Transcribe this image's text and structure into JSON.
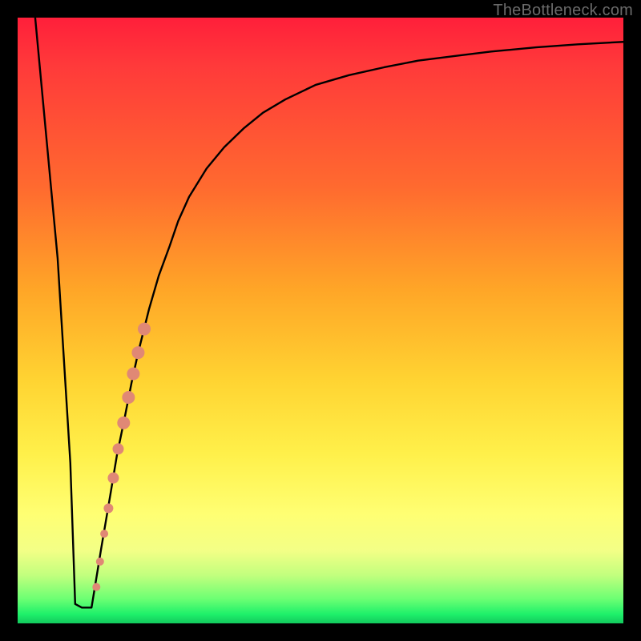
{
  "watermark": "TheBottleneck.com",
  "colors": {
    "background": "#000000",
    "curve": "#000000",
    "dot_fill": "#e08875",
    "gradient_top": "#ff1f3a",
    "gradient_bottom": "#13c95d"
  },
  "chart_data": {
    "type": "line",
    "title": "",
    "xlabel": "",
    "ylabel": "",
    "xlim": [
      0,
      100
    ],
    "ylim": [
      0,
      100
    ],
    "grid": false,
    "legend": false,
    "series": [
      {
        "name": "bottleneck-curve",
        "x": [
          2.9,
          6.6,
          8.7,
          9.5,
          10.6,
          12.2,
          13.8,
          15.3,
          16.4,
          17.7,
          18.8,
          19.9,
          21.7,
          23.3,
          25.1,
          26.5,
          28.3,
          31.2,
          34.1,
          37.3,
          40.5,
          44.2,
          49.2,
          54.7,
          60.5,
          66.1,
          72.4,
          78.2,
          85.6,
          92.5,
          100.0
        ],
        "y": [
          100.0,
          60.3,
          26.5,
          3.2,
          2.6,
          2.6,
          12.4,
          21.2,
          27.8,
          34.1,
          39.7,
          44.7,
          51.9,
          57.4,
          62.3,
          66.4,
          70.4,
          75.1,
          78.6,
          81.7,
          84.3,
          86.5,
          88.9,
          90.5,
          91.8,
          92.9,
          93.7,
          94.4,
          95.1,
          95.6,
          96.0
        ]
      }
    ],
    "markers": [
      {
        "name": "highlight-dots",
        "color": "#e08875",
        "points": [
          {
            "x": 13.0,
            "y": 6.0,
            "r": 5
          },
          {
            "x": 13.6,
            "y": 10.2,
            "r": 5
          },
          {
            "x": 14.3,
            "y": 14.8,
            "r": 5
          },
          {
            "x": 15.0,
            "y": 19.0,
            "r": 6
          },
          {
            "x": 15.8,
            "y": 24.0,
            "r": 7
          },
          {
            "x": 16.6,
            "y": 28.8,
            "r": 7
          },
          {
            "x": 17.5,
            "y": 33.1,
            "r": 8
          },
          {
            "x": 18.3,
            "y": 37.3,
            "r": 8
          },
          {
            "x": 19.1,
            "y": 41.2,
            "r": 8
          },
          {
            "x": 19.9,
            "y": 44.7,
            "r": 8
          },
          {
            "x": 20.9,
            "y": 48.6,
            "r": 8
          }
        ]
      }
    ]
  }
}
